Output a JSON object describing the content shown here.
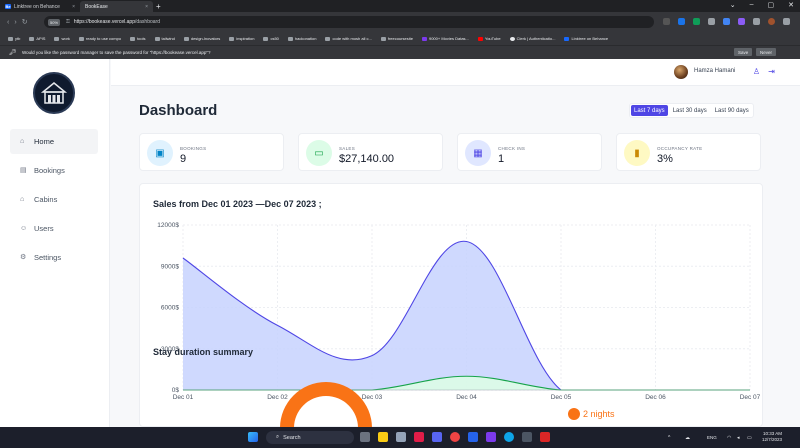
{
  "browser": {
    "tabs": [
      {
        "label": "Linktree on Behance",
        "icon": "Be"
      },
      {
        "label": "BookEase",
        "active": true
      }
    ],
    "address": {
      "zoom": "50%",
      "url_host": "https://bookease.vercel.app",
      "url_path": "/dashboard"
    },
    "bookmarks": [
      "ytb",
      "APIS",
      "work",
      "ready to use compo",
      "tools",
      "tailwind",
      "design-lnovators",
      "inspiration",
      "cs50",
      "hackonation",
      "code with mosh all c...",
      "freecoursesite",
      "9000+ Movies Datas...",
      "YouTube",
      "Clerk | Authenticatio...",
      "Linktree on Behance"
    ],
    "password_prompt": {
      "text": "Would you like the password manager to save the password for \"https://bookease.vercel.app\"?",
      "save": "Save",
      "never": "Never"
    }
  },
  "header": {
    "user_name": "Hamza Hamani"
  },
  "sidebar": {
    "items": [
      {
        "label": "Home",
        "icon": "home-icon",
        "active": true
      },
      {
        "label": "Bookings",
        "icon": "calendar-icon"
      },
      {
        "label": "Cabins",
        "icon": "house-icon"
      },
      {
        "label": "Users",
        "icon": "users-icon"
      },
      {
        "label": "Settings",
        "icon": "gear-icon"
      }
    ]
  },
  "main": {
    "title": "Dashboard",
    "filters": [
      "Last 7 days",
      "Last 30 days",
      "Last 90 days"
    ],
    "active_filter": "Last 7 days",
    "stats": [
      {
        "label": "BOOKINGS",
        "value": "9",
        "icon": "briefcase-icon",
        "color": "#e0f2fe",
        "icon_color": "#0284c7"
      },
      {
        "label": "SALES",
        "value": "$27,140.00",
        "icon": "banknote-icon",
        "color": "#dcfce7",
        "icon_color": "#16a34a"
      },
      {
        "label": "CHECK INS",
        "value": "1",
        "icon": "calendar-icon",
        "color": "#e0e7ff",
        "icon_color": "#4f46e5"
      },
      {
        "label": "OCCUPANCY RATE",
        "value": "3%",
        "icon": "bar-chart-icon",
        "color": "#fef9c3",
        "icon_color": "#ca8a04"
      }
    ],
    "sales_title": "Sales from Dec 01 2023 —Dec 07 2023 ;",
    "stay_title": "Stay duration summary",
    "stay_legend": "2 nights"
  },
  "chart_data": {
    "type": "area",
    "categories": [
      "Dec 01",
      "Dec 02",
      "Dec 03",
      "Dec 04",
      "Dec 05",
      "Dec 06",
      "Dec 07"
    ],
    "series": [
      {
        "values": [
          9600,
          4700,
          2500,
          10800,
          0,
          0,
          0
        ],
        "color": "#4f46e5",
        "fill": "#c7d2fe"
      },
      {
        "values": [
          0,
          0,
          0,
          1000,
          0,
          0,
          0
        ],
        "color": "#16a34a",
        "fill": "#dcfce7"
      }
    ],
    "yticks": [
      "0$",
      "3000$",
      "6000$",
      "9000$",
      "12000$"
    ],
    "ylim": [
      0,
      12000
    ],
    "grid": true
  },
  "taskbar": {
    "search": "Search",
    "lang": "ENG",
    "time": "10:33 AM",
    "date": "12/7/2023"
  }
}
